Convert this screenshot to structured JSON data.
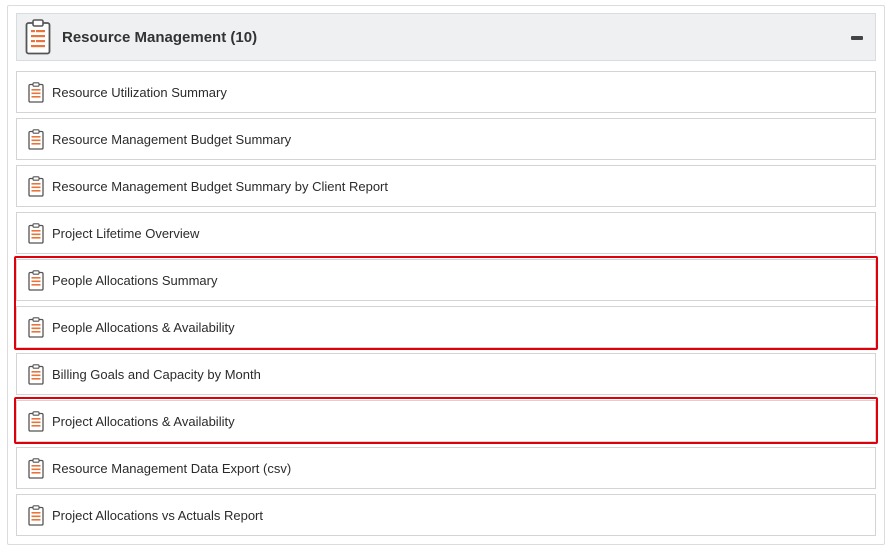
{
  "section": {
    "title": "Resource Management (10)",
    "icon": "clipboard-report-icon",
    "collapse_icon": "minus-icon"
  },
  "reports": [
    {
      "label": "Resource Utilization Summary",
      "icon": "clipboard-report-icon",
      "highlighted": false
    },
    {
      "label": "Resource Management Budget Summary",
      "icon": "clipboard-report-icon",
      "highlighted": false
    },
    {
      "label": "Resource Management Budget Summary by Client Report",
      "icon": "clipboard-report-icon",
      "highlighted": false
    },
    {
      "label": "Project Lifetime Overview",
      "icon": "clipboard-report-icon",
      "highlighted": false
    },
    {
      "label": "People Allocations Summary",
      "icon": "clipboard-report-icon",
      "highlighted": true
    },
    {
      "label": "People Allocations & Availability",
      "icon": "clipboard-report-icon",
      "highlighted": true
    },
    {
      "label": "Billing Goals and Capacity by Month",
      "icon": "clipboard-report-icon",
      "highlighted": false
    },
    {
      "label": "Project Allocations & Availability",
      "icon": "clipboard-report-icon",
      "highlighted": true
    },
    {
      "label": "Resource Management Data Export (csv)",
      "icon": "clipboard-report-icon",
      "highlighted": false
    },
    {
      "label": "Project Allocations vs Actuals Report",
      "icon": "clipboard-report-icon",
      "highlighted": false
    }
  ],
  "colors": {
    "highlight": "#e0000b",
    "icon_accent": "#e8743b",
    "header_bg": "#eef0f2"
  }
}
